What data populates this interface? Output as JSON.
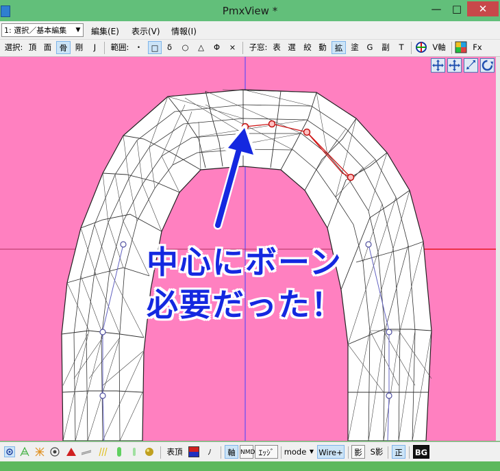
{
  "window": {
    "title": "PmxView *",
    "min_glyph": "—",
    "max_glyph": "□",
    "close_glyph": "✕"
  },
  "menubar": {
    "mode_select": "1: 選択／基本編集",
    "items": [
      "編集(E)",
      "表示(V)",
      "情報(I)"
    ]
  },
  "toolbar": {
    "select_label": "選択:",
    "select_items": [
      "頂",
      "面",
      "骨",
      "剛",
      "J"
    ],
    "range_label": "範囲:",
    "range_items": [
      "・",
      "□",
      "δ",
      "○",
      "△",
      "Φ",
      "×"
    ],
    "child_label": "子窓:",
    "child_items": [
      "表",
      "選",
      "絞",
      "動",
      "拡",
      "塗",
      "G",
      "副",
      "T"
    ],
    "v_axis_label": "V軸",
    "fx_label": "Fx"
  },
  "overlay": {
    "line1": "中心にボーン",
    "line2": "必要だった！"
  },
  "statusbar": {
    "label_vertex": "表頂",
    "label_no": "ﾉ",
    "axis_button": "軸",
    "nmd_button": "NMD",
    "edge_button": "ｴｯｼﾞ",
    "mode_button": "mode",
    "wire_button": "Wire+",
    "shadow_button": "影",
    "sshadow_button": "S影",
    "ortho_button": "正",
    "bg_button": "BG"
  },
  "colors": {
    "viewport_bg": "#ff80c0",
    "overlay_text": "#1428e0",
    "bone": "#d01818",
    "axis_blue": "#4040ff",
    "axis_red": "#e00000",
    "titlebar": "#62bf7a"
  },
  "icons": {
    "app": "app-icon",
    "nav": [
      "move-view-icon",
      "pan-view-icon",
      "zoom-view-icon",
      "rotate-view-icon"
    ],
    "status": [
      "point-mode-icon",
      "wire-green-icon",
      "wire-orange-icon",
      "circle-target-icon",
      "red-triangle-icon",
      "gray-wire-icon",
      "yellow-wire-icon",
      "green-capsule-icon",
      "green-capsule2-icon",
      "material-ball-icon"
    ]
  }
}
